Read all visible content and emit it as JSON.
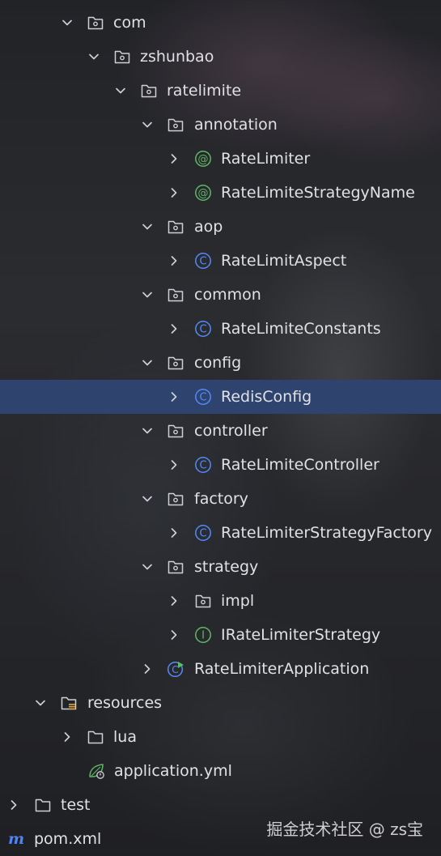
{
  "project_tree": {
    "items": [
      {
        "label": "com",
        "kind": "folder",
        "expanded": true
      },
      {
        "label": "zshunbao",
        "kind": "folder",
        "expanded": true
      },
      {
        "label": "ratelimite",
        "kind": "folder",
        "expanded": true
      },
      {
        "label": "annotation",
        "kind": "folder",
        "expanded": true
      },
      {
        "label": "RateLimiter",
        "kind": "annotation",
        "expanded": false
      },
      {
        "label": "RateLimiteStrategyName",
        "kind": "annotation",
        "expanded": false
      },
      {
        "label": "aop",
        "kind": "folder",
        "expanded": true
      },
      {
        "label": "RateLimitAspect",
        "kind": "class",
        "expanded": false
      },
      {
        "label": "common",
        "kind": "folder",
        "expanded": true
      },
      {
        "label": "RateLimiteConstants",
        "kind": "class",
        "expanded": false
      },
      {
        "label": "config",
        "kind": "folder",
        "expanded": true
      },
      {
        "label": "RedisConfig",
        "kind": "class",
        "expanded": false,
        "selected": true
      },
      {
        "label": "controller",
        "kind": "folder",
        "expanded": true
      },
      {
        "label": "RateLimiteController",
        "kind": "class",
        "expanded": false
      },
      {
        "label": "factory",
        "kind": "folder",
        "expanded": true
      },
      {
        "label": "RateLimiterStrategyFactory",
        "kind": "class",
        "expanded": false
      },
      {
        "label": "strategy",
        "kind": "folder",
        "expanded": true
      },
      {
        "label": "impl",
        "kind": "folder",
        "expanded": false
      },
      {
        "label": "IRateLimiterStrategy",
        "kind": "interface",
        "expanded": false
      },
      {
        "label": "RateLimiterApplication",
        "kind": "spring-app",
        "expanded": false
      },
      {
        "label": "resources",
        "kind": "resources-folder",
        "expanded": true
      },
      {
        "label": "lua",
        "kind": "plain-folder",
        "expanded": false
      },
      {
        "label": "application.yml",
        "kind": "spring-yml"
      },
      {
        "label": "test",
        "kind": "plain-folder",
        "expanded": false
      },
      {
        "label": "pom.xml",
        "kind": "maven"
      }
    ]
  },
  "watermark": {
    "text": "掘金技术社区 @ zs宝"
  },
  "colors": {
    "selection": "#2e436e",
    "folder_stroke": "#ced0d6",
    "class_icon": "#548af7",
    "annotation_icon": "#5fb865",
    "interface_icon": "#5fb865",
    "maven_icon": "#4d84f6",
    "text": "#dfe1e5"
  }
}
